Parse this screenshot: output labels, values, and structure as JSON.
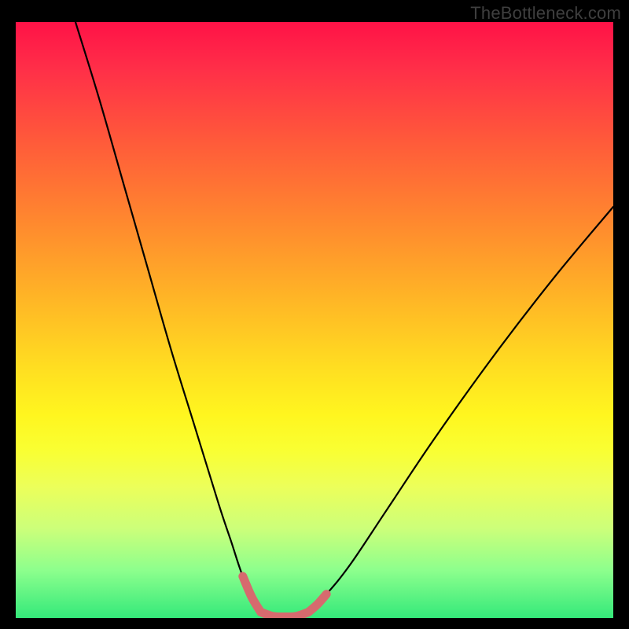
{
  "watermark": "TheBottleneck.com",
  "colors": {
    "curve_stroke": "#000000",
    "highlight_stroke": "#d66a6e",
    "background": "#000000"
  },
  "chart_data": {
    "type": "line",
    "title": "",
    "xlabel": "",
    "ylabel": "",
    "xlim": [
      0,
      100
    ],
    "ylim": [
      0,
      100
    ],
    "grid": false,
    "legend": false,
    "note": "Axes are unlabeled in the image; x/y are normalized 0–100 across the plot area. Values estimated from pixel positions.",
    "series": [
      {
        "name": "left-curve",
        "x": [
          10,
          14,
          18,
          22,
          26,
          30,
          34,
          36,
          38,
          40,
          41
        ],
        "y": [
          100,
          87,
          73,
          59,
          45,
          32,
          19,
          13,
          7,
          3,
          1
        ]
      },
      {
        "name": "valley-floor",
        "x": [
          41,
          43,
          45,
          47,
          49
        ],
        "y": [
          1,
          0.3,
          0.2,
          0.3,
          1
        ]
      },
      {
        "name": "right-curve",
        "x": [
          49,
          52,
          56,
          62,
          70,
          80,
          90,
          100
        ],
        "y": [
          1,
          4,
          9,
          18,
          30,
          44,
          57,
          69
        ]
      },
      {
        "name": "highlight-left-tip",
        "x": [
          38,
          39.5,
          41
        ],
        "y": [
          7,
          3.5,
          1
        ]
      },
      {
        "name": "highlight-floor",
        "x": [
          41,
          43,
          45,
          47,
          49
        ],
        "y": [
          1,
          0.3,
          0.2,
          0.3,
          1
        ]
      },
      {
        "name": "highlight-right-tip",
        "x": [
          49,
          50.5,
          52
        ],
        "y": [
          1,
          2.3,
          4
        ]
      }
    ]
  }
}
